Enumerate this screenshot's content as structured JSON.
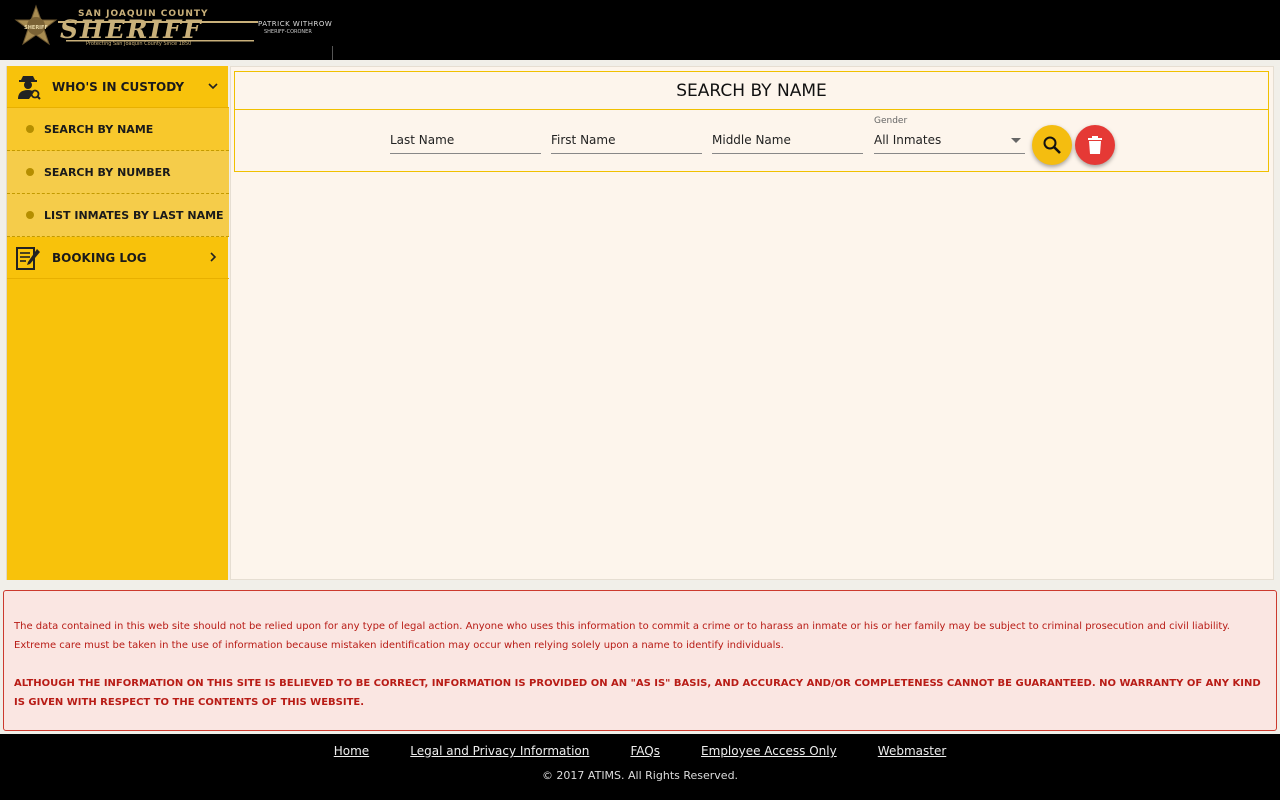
{
  "header": {
    "logo_county": "SAN JOAQUIN COUNTY",
    "logo_title": "SHERIFF",
    "logo_tagline": "Protecting San Joaquin County Since 1850",
    "logo_badge_text": "SHERIFF",
    "logo_officer_name": "PATRICK WITHROW",
    "logo_officer_title": "SHERIFF-CORONER"
  },
  "sidebar": {
    "sections": [
      {
        "label": "WHO'S IN CUSTODY",
        "icon": "detective-icon",
        "expanded": true
      },
      {
        "label": "BOOKING LOG",
        "icon": "booking-log-icon",
        "expanded": false
      }
    ],
    "sub_items": [
      {
        "label": "SEARCH BY NAME",
        "active": true
      },
      {
        "label": "SEARCH BY NUMBER",
        "active": false
      },
      {
        "label": "LIST INMATES BY LAST NAME",
        "active": false
      }
    ]
  },
  "search": {
    "title": "SEARCH BY NAME",
    "last_name_placeholder": "Last Name",
    "first_name_placeholder": "First Name",
    "middle_name_placeholder": "Middle Name",
    "gender_label": "Gender",
    "gender_value": "All Inmates",
    "search_icon": "magnify-icon",
    "clear_icon": "trash-icon"
  },
  "disclaimer": {
    "paragraph": "The data contained in this web site should not be relied upon for any type of legal action. Anyone who uses this information to commit a crime or to harass an inmate or his or her family may be subject to criminal prosecution and civil liability. Extreme care must be taken in the use of information because mistaken identification may occur when relying solely upon a name to identify individuals.",
    "warning": "ALTHOUGH THE INFORMATION ON THIS SITE IS BELIEVED TO BE CORRECT, INFORMATION IS PROVIDED ON AN \"AS IS\" BASIS, AND ACCURACY AND/OR COMPLETENESS CANNOT BE GUARANTEED. NO WARRANTY OF ANY KIND IS GIVEN WITH RESPECT TO THE CONTENTS OF THIS WEBSITE."
  },
  "footer": {
    "links": [
      "Home",
      "Legal and Privacy Information",
      "FAQs",
      "Employee Access Only",
      "Webmaster"
    ],
    "copyright": "© 2017 ATIMS. All Rights Reserved."
  },
  "colors": {
    "sidebar": "#f8c20b",
    "search_button": "#f4bd10",
    "clear_button": "#e53935",
    "disclaimer_text": "#b81c16"
  }
}
